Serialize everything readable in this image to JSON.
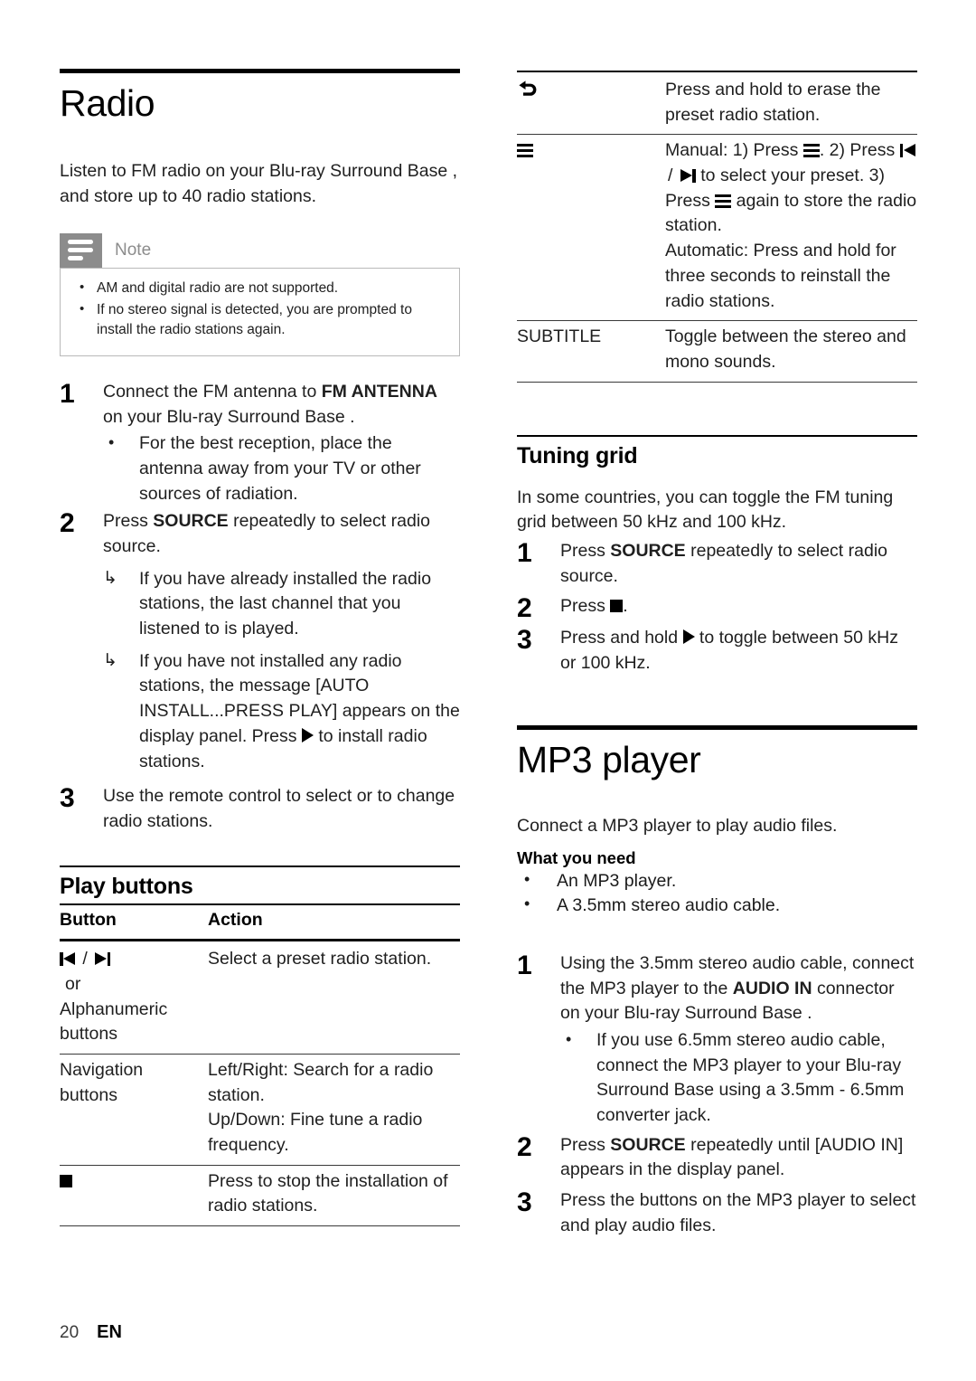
{
  "document": {
    "footer": {
      "page_number": "20",
      "language": "EN"
    }
  },
  "left_column": {
    "chapter_title": "Radio",
    "intro": "Listen to FM radio on your Blu-ray Surround Base , and store up to 40 radio stations.",
    "note": {
      "title": "Note",
      "icon": "note-lines-icon",
      "items": [
        "AM and digital radio are not supported.",
        "If no stereo signal is detected, you are prompted to install the radio stations again."
      ]
    },
    "steps": [
      {
        "number": "1",
        "text_parts": [
          {
            "text": "Connect the FM antenna to ",
            "bold": false
          },
          {
            "text": "FM ANTENNA",
            "bold": true
          },
          {
            "text": " on your Blu-ray Surround Base .",
            "bold": false
          }
        ],
        "plain_text": "Connect the FM antenna to FM ANTENNA on your Blu-ray Surround Base .",
        "bullets": [
          {
            "marker": "bullet",
            "text": "For the best reception, place the antenna away from your TV or other sources of radiation."
          }
        ]
      },
      {
        "number": "2",
        "plain_text": "Press SOURCE repeatedly to select radio source.",
        "bullets": [
          {
            "marker": "arrow",
            "text": "If you have already installed the radio stations, the last channel that you listened to is played."
          },
          {
            "marker": "arrow",
            "text": "If you have not installed any radio stations, the message [AUTO INSTALL...PRESS PLAY] appears on the display panel. Press ▶ to install radio stations."
          }
        ]
      },
      {
        "number": "3",
        "plain_text": "Use the remote control to select or to change radio stations.",
        "bullets": []
      }
    ],
    "play_buttons": {
      "heading": "Play buttons",
      "columns": [
        "Button",
        "Action"
      ],
      "rows": [
        {
          "button_icons": [
            "skip-previous-icon",
            "skip-next-icon"
          ],
          "button_label_lines": [
            "or",
            "Alphanumeric",
            "buttons"
          ],
          "action": "Select a preset radio station."
        },
        {
          "button_label_lines": [
            "Navigation",
            "buttons"
          ],
          "action_lines": [
            "Left/Right: Search for a radio station.",
            "Up/Down: Fine tune a radio frequency."
          ]
        },
        {
          "button_icons": [
            "stop-icon"
          ],
          "action": "Press to stop the installation of radio stations."
        }
      ]
    }
  },
  "right_column": {
    "table_continued": {
      "rows": [
        {
          "button_icon": "back-arrow-icon",
          "action": "Press and hold to erase the preset radio station."
        },
        {
          "button_icon": "menu-icon",
          "action_manual_prefix": "Manual: 1) Press ",
          "action_manual_mid": ". 2) Press ",
          "action_manual_mid2": " to select your preset. 3) Press ",
          "action_manual_suffix": " again to store the radio station.",
          "action_automatic": "Automatic: Press and hold for three seconds to reinstall the radio stations."
        },
        {
          "button_label": "SUBTITLE",
          "action": "Toggle between the stereo and mono sounds."
        }
      ]
    },
    "tuning_grid": {
      "heading": "Tuning grid",
      "intro": "In some countries, you can toggle the FM tuning grid between 50 kHz and 100 kHz.",
      "steps": [
        {
          "number": "1",
          "text": "Press SOURCE repeatedly to select radio source."
        },
        {
          "number": "2",
          "text_prefix": "Press ",
          "icon": "stop-icon",
          "text_suffix": "."
        },
        {
          "number": "3",
          "text_prefix": "Press and hold ",
          "icon": "play-icon",
          "text_suffix": " to toggle between 50 kHz or 100 kHz."
        }
      ]
    },
    "mp3_player": {
      "chapter_title": "MP3 player",
      "intro": "Connect a MP3 player to play audio files.",
      "what_you_need": {
        "heading": "What you need",
        "items": [
          "An MP3 player.",
          "A 3.5mm stereo audio cable."
        ]
      },
      "steps": [
        {
          "number": "1",
          "plain_text": "Using the 3.5mm stereo audio cable, connect the MP3 player to the AUDIO IN connector on your Blu-ray Surround Base .",
          "bullets": [
            {
              "marker": "bullet",
              "text": "If you use 6.5mm stereo audio cable, connect the MP3 player to your Blu-ray Surround Base  using a 3.5mm - 6.5mm converter jack."
            }
          ]
        },
        {
          "number": "2",
          "plain_text": "Press SOURCE repeatedly until [AUDIO IN] appears in the display panel.",
          "bullets": []
        },
        {
          "number": "3",
          "plain_text": "Press the buttons on the MP3 player to select and play audio files.",
          "bullets": []
        }
      ]
    }
  },
  "inline_text": {
    "fm_antenna_bold": "FM ANTENNA",
    "source_bold": "SOURCE",
    "audio_in_bold": "AUDIO IN",
    "connect_prefix": "Connect the FM antenna to ",
    "connect_suffix": " on your Blu-ray Surround Base .",
    "press_prefix": "Press ",
    "press_source_suffix": " repeatedly to select radio source.",
    "press_source_until_suffix": " repeatedly until [AUDIO IN] appears in the display panel.",
    "using_cable_prefix": "Using the 3.5mm stereo audio cable, connect the MP3 player to the ",
    "using_cable_suffix": " connector on your Blu-ray Surround Base .",
    "auto_bullet_prefix": "If you have not installed any radio stations, the message [AUTO INSTALL...PRESS PLAY] appears on the display panel. Press ",
    "auto_bullet_suffix": " to install radio stations.",
    "manual_prefix": "Manual: 1) Press ",
    "manual_mid": ". 2) Press ",
    "manual_mid2": " to select your preset. 3) Press ",
    "manual_suffix": " again to store the radio station.",
    "automatic_line": "Automatic: Press and hold for three seconds to reinstall the radio stations.",
    "press_word": "Press ",
    "period": ".",
    "press_hold_prefix": "Press and hold ",
    "toggle_suffix": " to toggle between 50 kHz or 100 kHz.",
    "slash": " / ",
    "or_word": "or"
  },
  "colors": {
    "note_grey": "#8c8c8c",
    "note_border": "#b9b9b9",
    "text": "#1f1f1f",
    "rule": "#000000"
  }
}
